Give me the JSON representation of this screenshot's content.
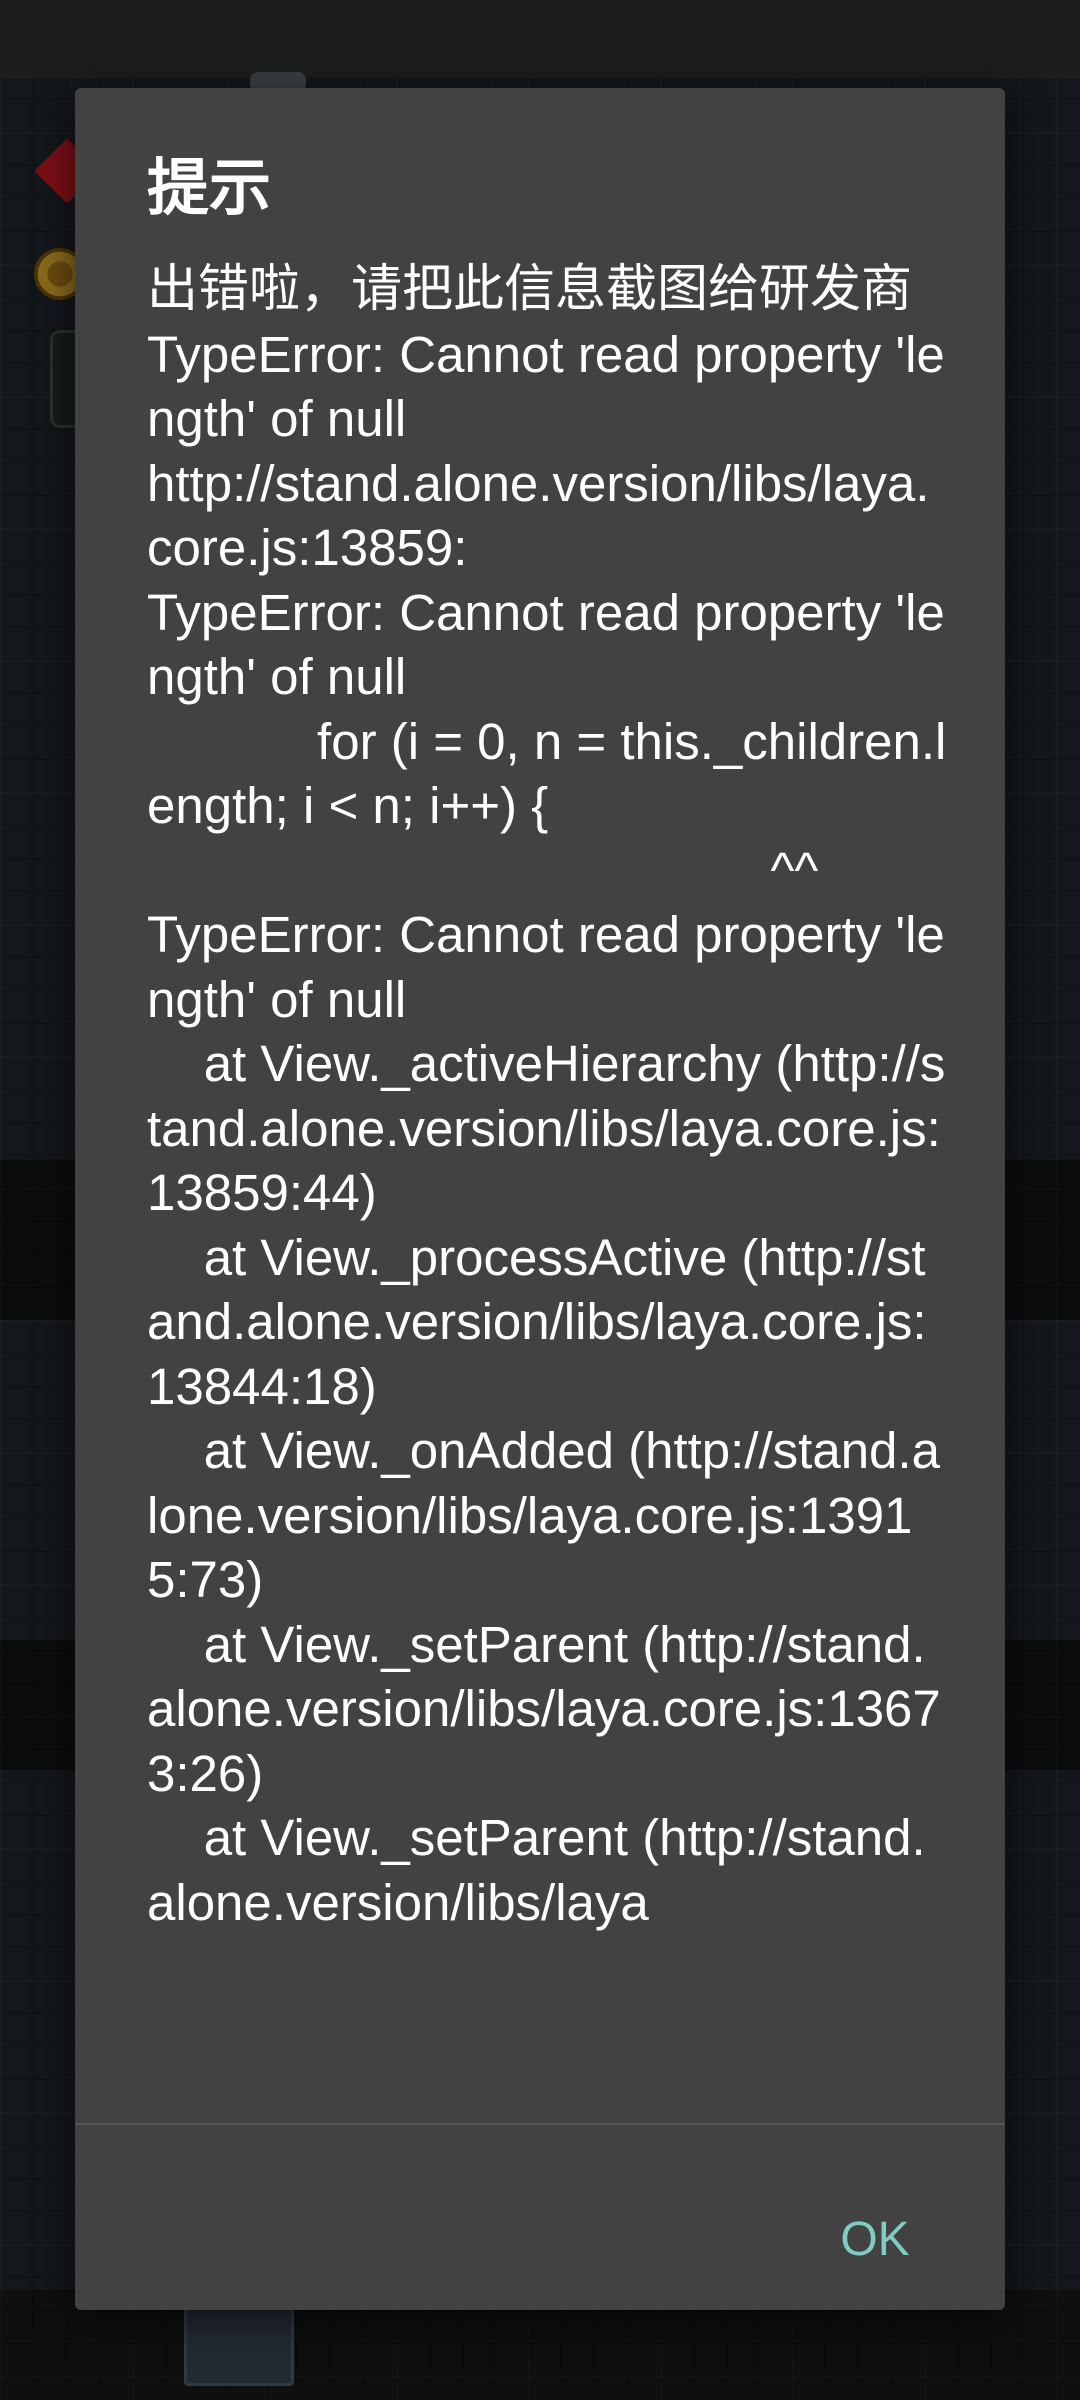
{
  "dialog": {
    "title": "提示",
    "message_heading": "出错啦，请把此信息截图给研发商",
    "error_text": "TypeError: Cannot read property 'length' of null\nhttp://stand.alone.version/libs/laya.core.js:13859:\nTypeError: Cannot read property 'length' of null\n            for (i = 0, n = this._children.length; i < n; i++) {\n                                            ^^\nTypeError: Cannot read property 'length' of null\n    at View._activeHierarchy (http://stand.alone.version/libs/laya.core.js:13859:44)\n    at View._processActive (http://stand.alone.version/libs/laya.core.js:13844:18)\n    at View._onAdded (http://stand.alone.version/libs/laya.core.js:13915:73)\n    at View._setParent (http://stand.alone.version/libs/laya.core.js:13673:26)\n    at View._setParent (http://stand.alone.version/libs/laya",
    "ok_label": "OK"
  },
  "colors": {
    "dialog_background": "#424242",
    "text": "#ffffff",
    "accent": "#80cbc4",
    "scrim": "#0e0f11"
  },
  "icons": {
    "diamond": "red-diamond-icon",
    "coin": "gold-coin-icon",
    "chair": "chair-icon"
  }
}
